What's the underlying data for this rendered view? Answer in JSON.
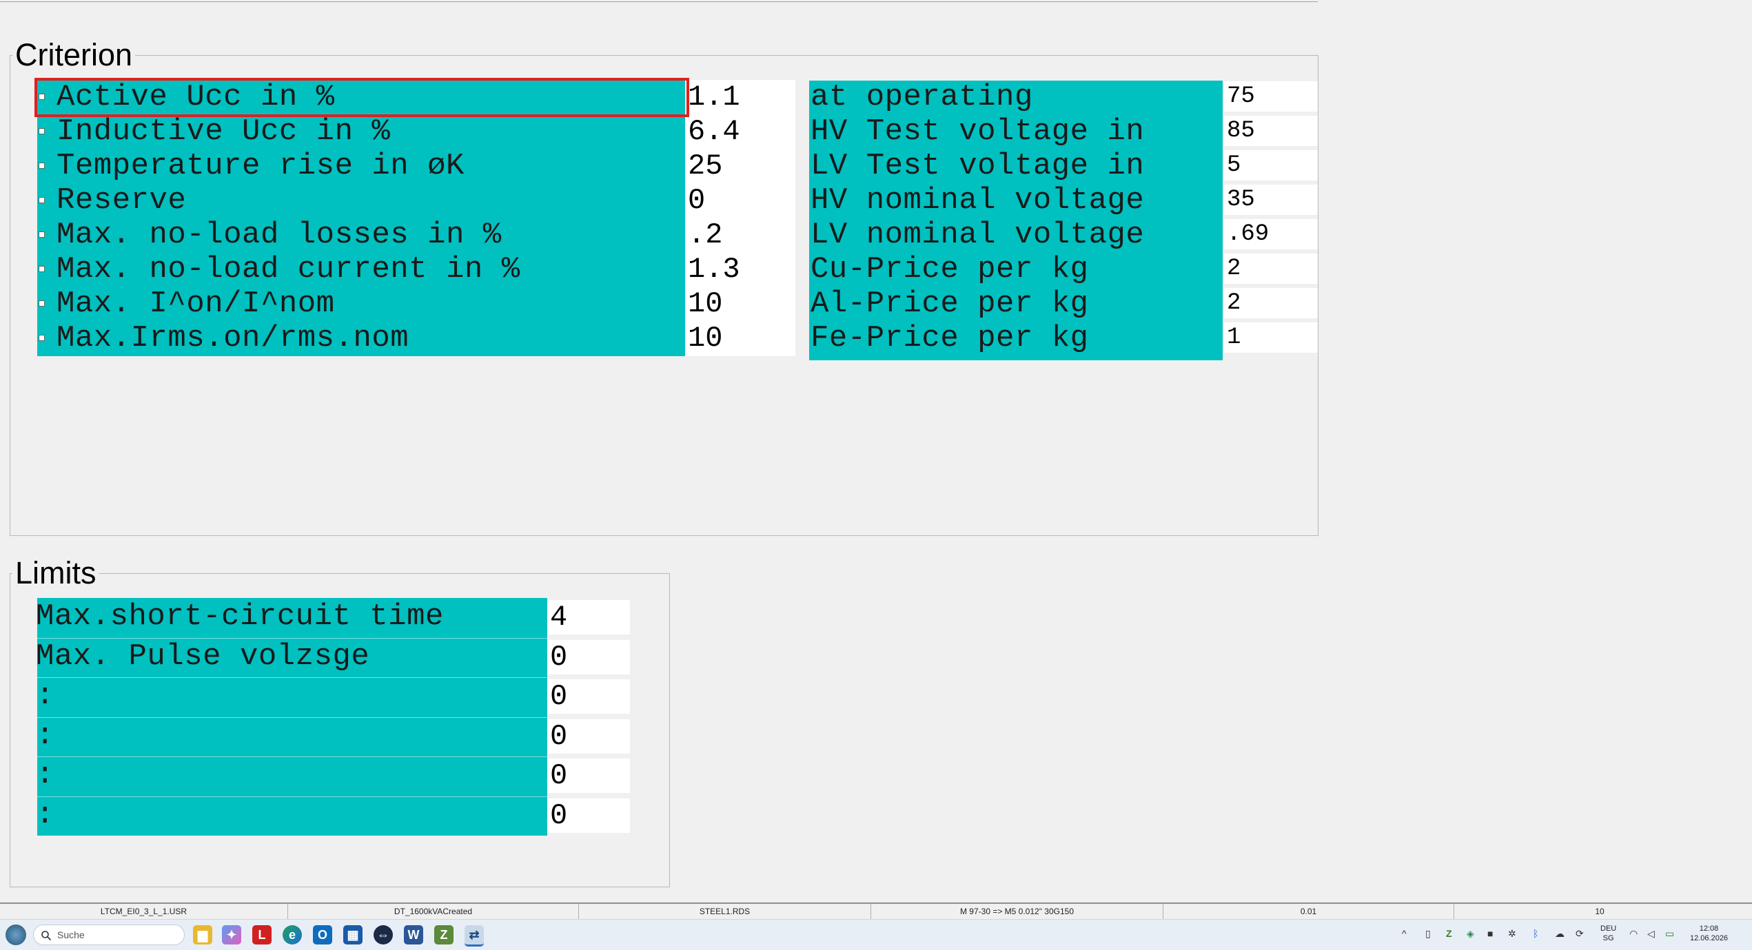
{
  "top_strip": {
    "labels": [
      "",
      "",
      "",
      ""
    ]
  },
  "criterion": {
    "title": "Criterion",
    "left_rows": [
      {
        "label": "Active Ucc in %",
        "value": "1.1"
      },
      {
        "label": "Inductive Ucc in %",
        "value": "6.4"
      },
      {
        "label": "Temperature rise in øK",
        "value": "25"
      },
      {
        "label": "Reserve",
        "value": "0"
      },
      {
        "label": "Max. no-load losses in %",
        "value": ".2"
      },
      {
        "label": "Max. no-load current in %",
        "value": "1.3"
      },
      {
        "label": "Max. I^on/I^nom",
        "value": "10"
      },
      {
        "label": "Max.Irms.on/rms.nom",
        "value": "10"
      }
    ],
    "right_rows": [
      {
        "label": "at operating",
        "value": "75"
      },
      {
        "label": "HV Test voltage in",
        "value": "85"
      },
      {
        "label": "LV Test voltage in",
        "value": "5"
      },
      {
        "label": "HV nominal voltage",
        "value": "35"
      },
      {
        "label": "LV nominal voltage",
        "value": ".69"
      },
      {
        "label": "Cu-Price per kg",
        "value": "2"
      },
      {
        "label": "Al-Price per kg",
        "value": "2"
      },
      {
        "label": "Fe-Price per kg",
        "value": "1"
      }
    ]
  },
  "limits": {
    "title": "Limits",
    "rows": [
      {
        "label": "Max.short-circuit time",
        "value": "4"
      },
      {
        "label": "Max. Pulse volzsge",
        "value": "0"
      },
      {
        "label": ":",
        "value": "0"
      },
      {
        "label": ":",
        "value": "0"
      },
      {
        "label": ":",
        "value": "0"
      },
      {
        "label": ":",
        "value": "0"
      }
    ]
  },
  "status_bar": {
    "cells": [
      "LTCM_EI0_3_L_1.USR",
      "DT_1600kVACreated",
      "STEEL1.RDS",
      "M 97-30 => M5 0.012\" 30G150",
      "0.01",
      "10"
    ]
  },
  "taskbar": {
    "search_placeholder": "Suche",
    "language": "DEU",
    "language_sub": "SG",
    "time": "12:08",
    "date": "12.06.2026"
  },
  "colors": {
    "teal": "#00c0c0",
    "selection": "#e02020"
  }
}
